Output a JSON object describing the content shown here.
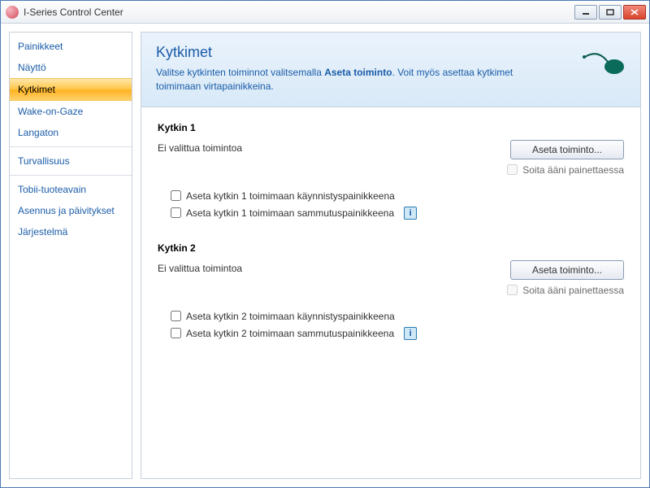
{
  "window": {
    "title": "I-Series Control Center"
  },
  "sidebar": {
    "groups": [
      {
        "items": [
          "Painikkeet",
          "Näyttö",
          "Kytkimet",
          "Wake-on-Gaze",
          "Langaton"
        ]
      },
      {
        "items": [
          "Turvallisuus"
        ]
      },
      {
        "items": [
          "Tobii-tuoteavain",
          "Asennus ja päivitykset",
          "Järjestelmä"
        ]
      }
    ],
    "selected": "Kytkimet"
  },
  "header": {
    "title": "Kytkimet",
    "desc_pre": "Valitse kytkinten toiminnot valitsemalla ",
    "desc_bold": "Aseta toiminto",
    "desc_post": ". Voit myös asettaa kytkimet toimimaan virtapainikkeina."
  },
  "switches": [
    {
      "title": "Kytkin 1",
      "status": "Ei valittua toimintoa",
      "set_button": "Aseta toiminto...",
      "play_sound": "Soita ääni painettaessa",
      "as_power_on": "Aseta kytkin 1 toimimaan käynnistyspainikkeena",
      "as_power_off": "Aseta kytkin 1 toimimaan sammutuspainikkeena"
    },
    {
      "title": "Kytkin 2",
      "status": "Ei valittua toimintoa",
      "set_button": "Aseta toiminto...",
      "play_sound": "Soita ääni painettaessa",
      "as_power_on": "Aseta kytkin 2 toimimaan käynnistyspainikkeena",
      "as_power_off": "Aseta kytkin 2 toimimaan sammutuspainikkeena"
    }
  ]
}
